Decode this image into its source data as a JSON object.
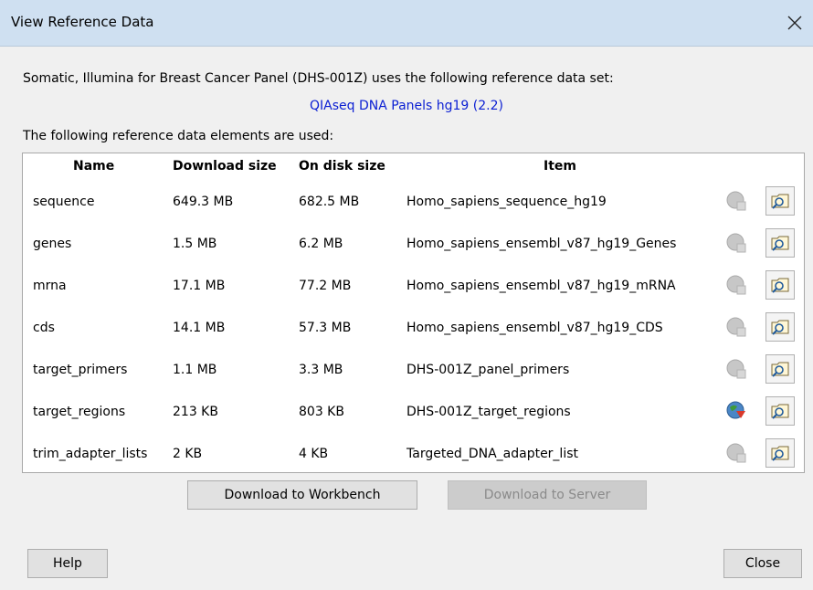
{
  "window": {
    "title": "View Reference Data"
  },
  "intro_text": "Somatic, Illumina for Breast Cancer Panel (DHS-001Z) uses the following reference data set:",
  "reference_set_link": "QIAseq DNA Panels hg19 (2.2)",
  "elements_label": "The following reference data elements are used:",
  "table": {
    "headers": {
      "name": "Name",
      "download_size": "Download size",
      "disk_size": "On disk size",
      "item": "Item"
    },
    "rows": [
      {
        "name": "sequence",
        "download_size": "649.3 MB",
        "disk_size": "682.5 MB",
        "item": "Homo_sapiens_sequence_hg19",
        "download_icon": "download-disabled"
      },
      {
        "name": "genes",
        "download_size": "1.5 MB",
        "disk_size": "6.2 MB",
        "item": "Homo_sapiens_ensembl_v87_hg19_Genes",
        "download_icon": "download-disabled"
      },
      {
        "name": "mrna",
        "download_size": "17.1 MB",
        "disk_size": "77.2 MB",
        "item": "Homo_sapiens_ensembl_v87_hg19_mRNA",
        "download_icon": "download-disabled"
      },
      {
        "name": "cds",
        "download_size": "14.1 MB",
        "disk_size": "57.3 MB",
        "item": "Homo_sapiens_ensembl_v87_hg19_CDS",
        "download_icon": "download-disabled"
      },
      {
        "name": "target_primers",
        "download_size": "1.1 MB",
        "disk_size": "3.3 MB",
        "item": "DHS-001Z_panel_primers",
        "download_icon": "download-disabled"
      },
      {
        "name": "target_regions",
        "download_size": "213 KB",
        "disk_size": "803 KB",
        "item": "DHS-001Z_target_regions",
        "download_icon": "download-active"
      },
      {
        "name": "trim_adapter_lists",
        "download_size": "2 KB",
        "disk_size": "4 KB",
        "item": "Targeted_DNA_adapter_list",
        "download_icon": "download-disabled"
      }
    ]
  },
  "buttons": {
    "download_workbench": "Download to Workbench",
    "download_server": "Download to Server",
    "help": "Help",
    "close": "Close"
  },
  "colors": {
    "titlebar": "#cfe0f1",
    "link": "#0b1fd3",
    "dialog_bg": "#f0f0f0",
    "download_active_green": "#3f9a3a",
    "download_active_red": "#d8392b"
  }
}
